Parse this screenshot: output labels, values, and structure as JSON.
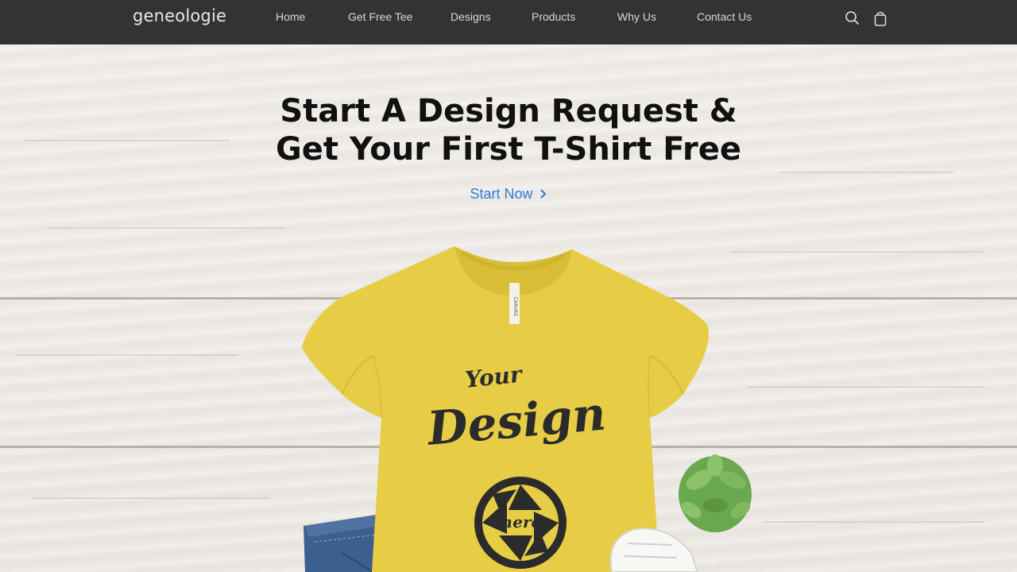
{
  "nav": {
    "logo": "geneologie",
    "links": [
      "Home",
      "Get Free Tee",
      "Designs",
      "Products",
      "Why Us",
      "Contact Us"
    ],
    "icons": [
      "search-icon",
      "shopping-bag-icon"
    ]
  },
  "hero": {
    "headline_line1": "Start A Design Request &",
    "headline_line2": "Get Your First T-Shirt Free",
    "cta_label": "Start Now",
    "shirt_text_1": "Your",
    "shirt_text_2": "Design",
    "shirt_text_3": "here",
    "tag_text": "CANVAS"
  },
  "colors": {
    "nav_bg": "#333333",
    "cta": "#2a7fd4",
    "shirt": "#e6cd45",
    "wood": "#eeebe6"
  }
}
